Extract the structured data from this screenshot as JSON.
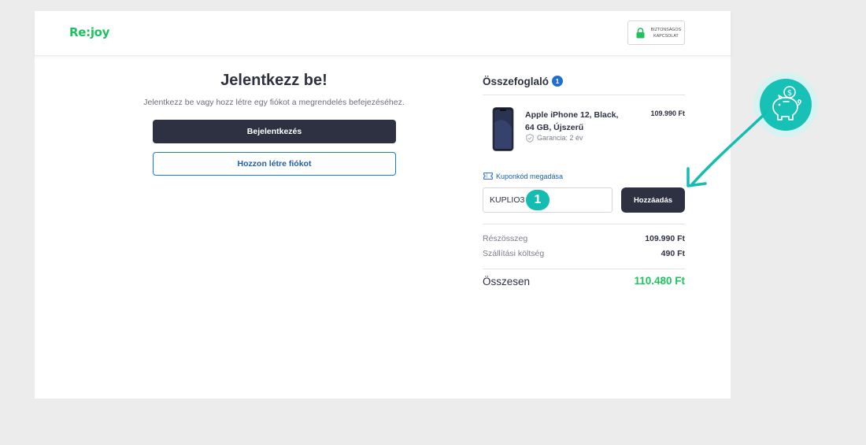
{
  "header": {
    "logo": "Re:joy",
    "secure_badge": "BIZTONSÁGOS KAPCSOLAT"
  },
  "login": {
    "title": "Jelentkezz be!",
    "subtitle": "Jelentkezz be vagy hozz létre egy fiókot a megrendelés befejezéséhez.",
    "login_button": "Bejelentkezés",
    "create_account_button": "Hozzon létre fiókot"
  },
  "summary": {
    "title": "Összefoglaló",
    "item_count": "1",
    "product": {
      "name": "Apple iPhone 12, Black, 64 GB, Újszerű",
      "price": "109.990 Ft",
      "warranty": "Garancia: 2 év"
    },
    "coupon": {
      "label": "Kuponkód megadása",
      "value": "KUPLIO3",
      "add_button": "Hozzáadás"
    },
    "subtotal_label": "Részösszeg",
    "subtotal_value": "109.990 Ft",
    "shipping_label": "Szállítási költség",
    "shipping_value": "490 Ft",
    "total_label": "Összesen",
    "total_value": "110.480 Ft"
  },
  "annotation": {
    "step_number": "1",
    "icon": "piggy-bank-coin-icon"
  },
  "colors": {
    "brand_green": "#1ec35f",
    "dark_button": "#2d3142",
    "accent_blue": "#1f6fd1",
    "annotation_teal": "#15bcb2"
  }
}
